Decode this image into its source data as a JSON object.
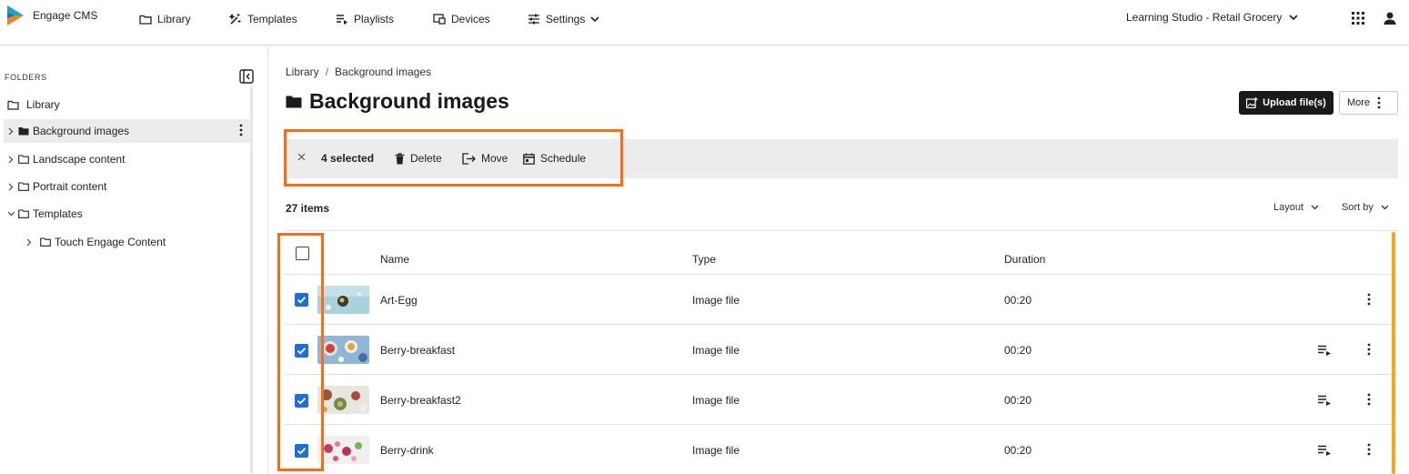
{
  "app": {
    "name": "Engage CMS"
  },
  "nav": [
    {
      "label": "Library",
      "icon": "folder-icon"
    },
    {
      "label": "Templates",
      "icon": "magic-wand-icon"
    },
    {
      "label": "Playlists",
      "icon": "playlist-icon"
    },
    {
      "label": "Devices",
      "icon": "devices-icon"
    },
    {
      "label": "Settings",
      "icon": "sliders-icon"
    }
  ],
  "org": {
    "label": "Learning Studio - Retail Grocery"
  },
  "sidebar": {
    "heading": "FOLDERS",
    "items": [
      {
        "label": "Library"
      },
      {
        "label": "Background images"
      },
      {
        "label": "Landscape content"
      },
      {
        "label": "Portrait content"
      },
      {
        "label": "Templates"
      },
      {
        "label": "Touch Engage Content"
      }
    ]
  },
  "breadcrumb": {
    "root": "Library",
    "sep": "/",
    "current": "Background images"
  },
  "page": {
    "title": "Background images"
  },
  "actions": {
    "upload": "Upload file(s)",
    "more": "More"
  },
  "selection": {
    "count_label": "4 selected",
    "delete": "Delete",
    "move": "Move",
    "schedule": "Schedule"
  },
  "list": {
    "count": "27 items",
    "layout": "Layout",
    "sort": "Sort by",
    "columns": {
      "name": "Name",
      "type": "Type",
      "duration": "Duration"
    },
    "rows": [
      {
        "name": "Art-Egg",
        "type": "Image file",
        "duration": "00:20",
        "checked": true
      },
      {
        "name": "Berry-breakfast",
        "type": "Image file",
        "duration": "00:20",
        "checked": true
      },
      {
        "name": "Berry-breakfast2",
        "type": "Image file",
        "duration": "00:20",
        "checked": true
      },
      {
        "name": "Berry-drink",
        "type": "Image file",
        "duration": "00:20",
        "checked": true
      }
    ]
  },
  "colors": {
    "accent": "#1e6fd9",
    "highlight": "#ff6a13",
    "brand_orange": "#f5821f",
    "brand_teal": "#1aa7c4"
  }
}
